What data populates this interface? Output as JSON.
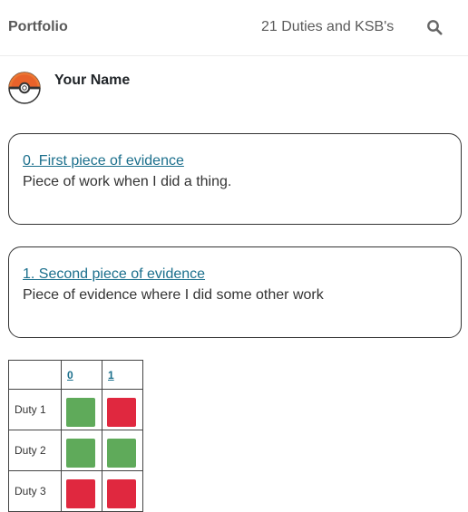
{
  "header": {
    "brand": "Portfolio",
    "nav_link": "21 Duties and KSB's",
    "search_icon": "search-icon"
  },
  "profile": {
    "name": "Your Name",
    "avatar_icon": "pokeball-avatar"
  },
  "evidence": [
    {
      "link": "0. First piece of evidence",
      "description": "Piece of work when I did a thing."
    },
    {
      "link": "1. Second piece of evidence",
      "description": "Piece of evidence where I did some other work"
    }
  ],
  "matrix": {
    "columns": [
      "0",
      "1"
    ],
    "rows": [
      {
        "label": "Duty 1",
        "status": [
          "met",
          "not-met"
        ]
      },
      {
        "label": "Duty 2",
        "status": [
          "met",
          "met"
        ]
      },
      {
        "label": "Duty 3",
        "status": [
          "not-met",
          "not-met"
        ]
      }
    ],
    "colors": {
      "met": "#5faa5a",
      "not-met": "#e0283f"
    }
  }
}
